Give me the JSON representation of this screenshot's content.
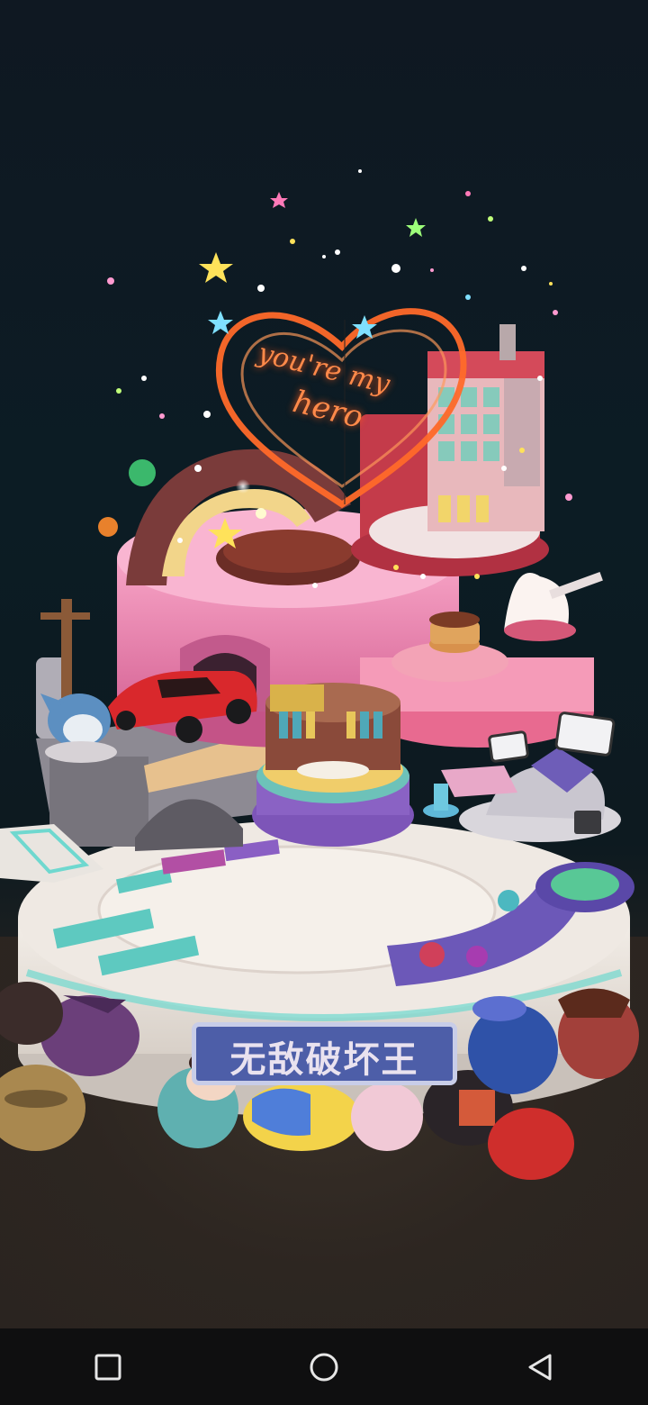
{
  "scene": {
    "neon_sign_line1": "you're my",
    "neon_sign_line2": "hero",
    "banner_text": "无敌破坏王",
    "colors": {
      "background": "#0c1c24",
      "neon": "#ff7a3a",
      "platform": "#ece6df",
      "cake_pink": "#f07fae",
      "banner": "#4d5ea8"
    }
  },
  "nav": {
    "recents_icon": "square-icon",
    "home_icon": "circle-icon",
    "back_icon": "triangle-back-icon"
  }
}
